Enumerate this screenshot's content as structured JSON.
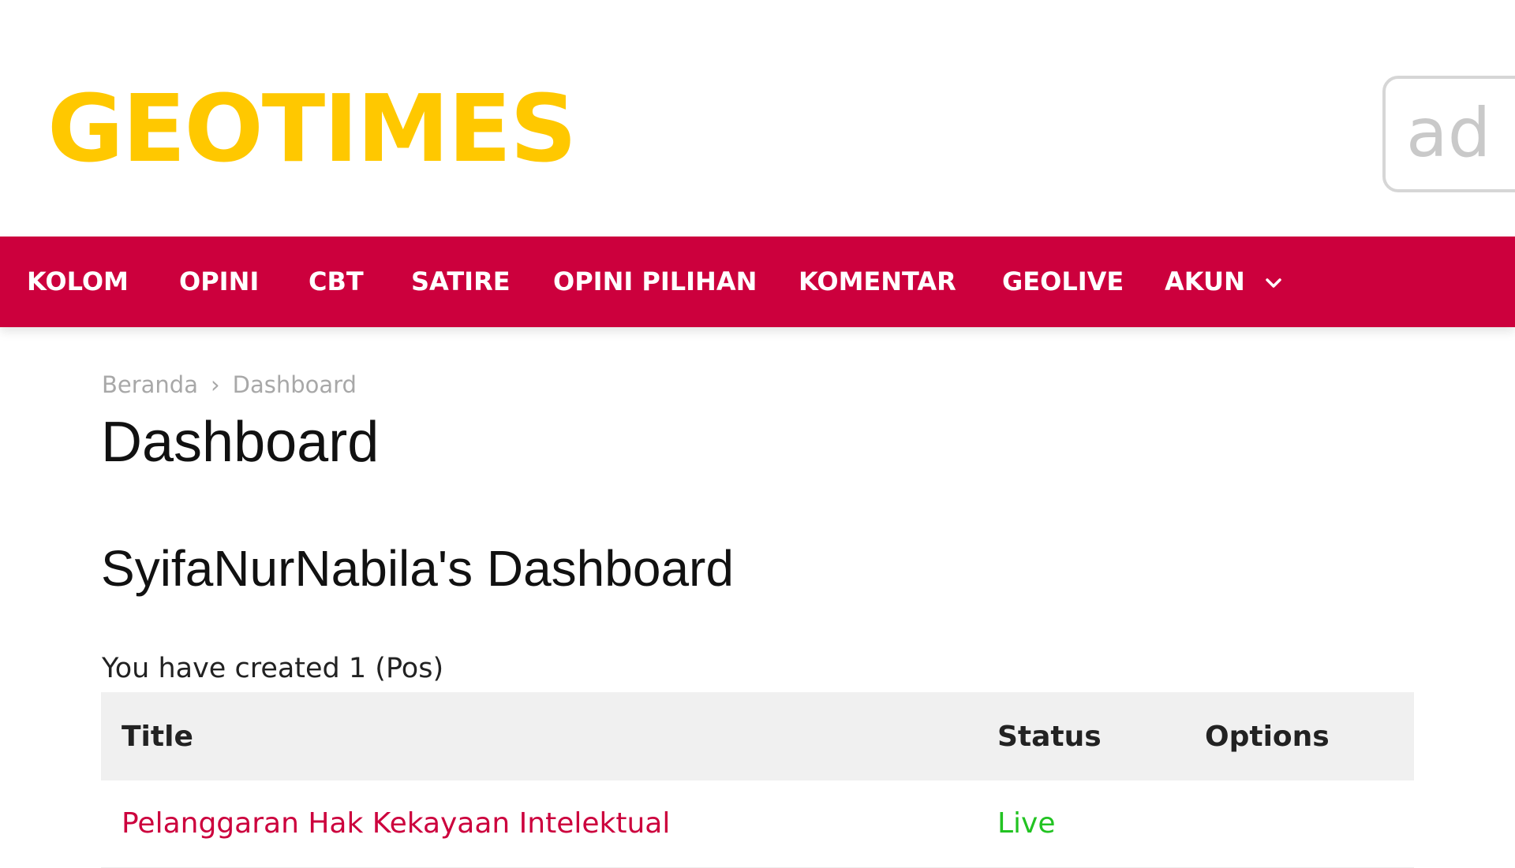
{
  "brand": {
    "logo_text": "GEOTIMES",
    "logo_color": "#ffc800"
  },
  "ad": {
    "text": "ad"
  },
  "nav": {
    "background_color": "#cc003d",
    "items": [
      {
        "label": "KOLOM"
      },
      {
        "label": "OPINI"
      },
      {
        "label": "CBT"
      },
      {
        "label": "SATIRE"
      },
      {
        "label": "OPINI PILIHAN"
      },
      {
        "label": "KOMENTAR"
      },
      {
        "label": "GEOLIVE"
      },
      {
        "label": "AKUN",
        "icon": "chevron-down-icon"
      }
    ]
  },
  "breadcrumb": {
    "home": "Beranda",
    "separator": "›",
    "current": "Dashboard"
  },
  "page": {
    "title": "Dashboard",
    "dashboard_heading": "SyifaNurNabila's Dashboard",
    "created_text": "You have created 1 (Pos)"
  },
  "table": {
    "headers": {
      "title": "Title",
      "status": "Status",
      "options": "Options"
    },
    "rows": [
      {
        "title": "Pelanggaran Hak Kekayaan Intelektual",
        "status": "Live",
        "options": ""
      }
    ]
  },
  "colors": {
    "link": "#cc003d",
    "status_live": "#22c322",
    "table_header_bg": "#f0f0f0"
  }
}
